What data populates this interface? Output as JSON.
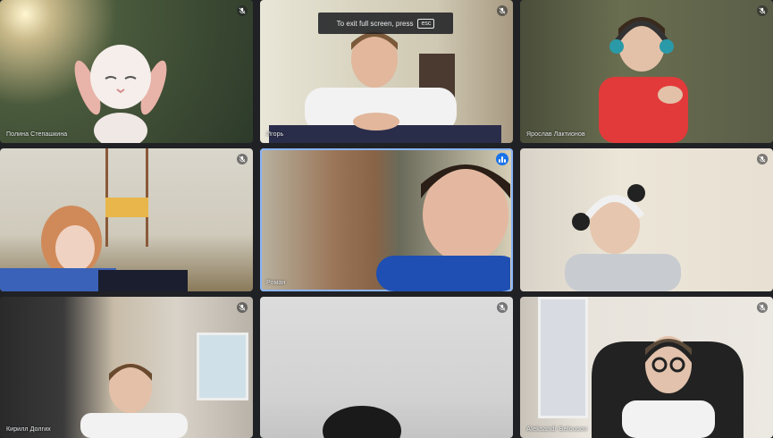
{
  "fullscreen_toast": {
    "message": "To exit full screen, press",
    "key": "esc"
  },
  "participants": [
    {
      "name": "Полина Степашкина",
      "muted": true
    },
    {
      "name": "Игорь",
      "muted": true
    },
    {
      "name": "Ярослав Лактионов",
      "muted": true
    },
    {
      "name": "",
      "muted": true
    },
    {
      "name": "Роман",
      "muted": false,
      "speaking": true
    },
    {
      "name": "",
      "muted": true
    },
    {
      "name": "Кирилл Долгих",
      "muted": true
    },
    {
      "name": "",
      "muted": true
    },
    {
      "name": "Aleksandr Belousov",
      "muted": true
    }
  ],
  "colors": {
    "speaking_border": "#8ab4f8",
    "speaking_indicator": "#1a73e8",
    "background": "#202124"
  },
  "icons": {
    "mute": "mic-off-icon",
    "speaking": "audio-level-icon"
  }
}
